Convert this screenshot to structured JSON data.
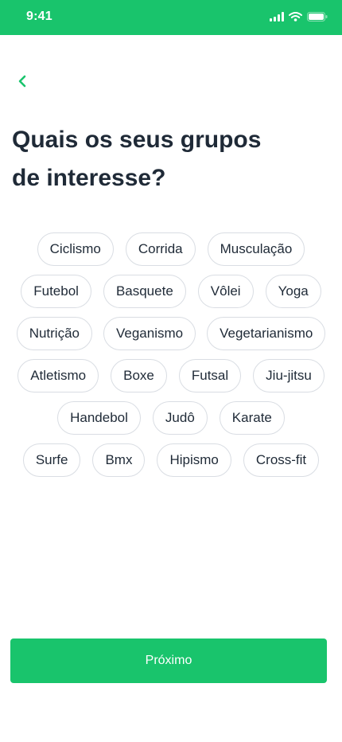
{
  "status_bar": {
    "time": "9:41",
    "icons": [
      "cellular-signal-icon",
      "wifi-icon",
      "battery-icon"
    ]
  },
  "header": {
    "back_icon": "chevron-left-icon",
    "title_line1": "Quais os seus grupos",
    "title_line2": "de interesse?"
  },
  "interests": {
    "rows": [
      [
        "Ciclismo",
        "Corrida",
        "Musculação"
      ],
      [
        "Futebol",
        "Basquete",
        "Vôlei",
        "Yoga"
      ],
      [
        "Nutrição",
        "Veganismo",
        "Vegetarianismo"
      ],
      [
        "Atletismo",
        "Boxe",
        "Futsal",
        "Jiu-jitsu"
      ],
      [
        "Handebol",
        "Judô",
        "Karate"
      ],
      [
        "Surfe",
        "Bmx",
        "Hipismo",
        "Cross-fit"
      ]
    ]
  },
  "footer": {
    "next_label": "Próximo"
  },
  "colors": {
    "accent": "#19c46c",
    "text": "#1f2a37",
    "chip_border": "#d9dde3"
  }
}
